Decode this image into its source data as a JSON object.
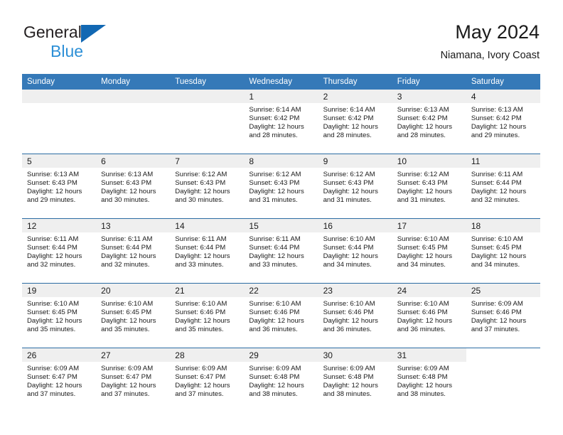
{
  "brand": {
    "name_part1": "General",
    "name_part2": "Blue",
    "logo_icon": "triangle-logo-icon",
    "accent_color": "#1268b3",
    "secondary_color": "#2c8fd6"
  },
  "header": {
    "title": "May 2024",
    "subtitle": "Niamana, Ivory Coast"
  },
  "theme": {
    "header_bg": "#3579b8",
    "row_divider": "#2b6ca3",
    "daynum_band_bg": "#efefef",
    "text_color": "#1a1a1a"
  },
  "calendar": {
    "weekday_headers": [
      "Sunday",
      "Monday",
      "Tuesday",
      "Wednesday",
      "Thursday",
      "Friday",
      "Saturday"
    ],
    "weeks": [
      [
        {
          "day": "",
          "lines": []
        },
        {
          "day": "",
          "lines": []
        },
        {
          "day": "",
          "lines": []
        },
        {
          "day": "1",
          "lines": [
            "Sunrise: 6:14 AM",
            "Sunset: 6:42 PM",
            "Daylight: 12 hours",
            "and 28 minutes."
          ]
        },
        {
          "day": "2",
          "lines": [
            "Sunrise: 6:14 AM",
            "Sunset: 6:42 PM",
            "Daylight: 12 hours",
            "and 28 minutes."
          ]
        },
        {
          "day": "3",
          "lines": [
            "Sunrise: 6:13 AM",
            "Sunset: 6:42 PM",
            "Daylight: 12 hours",
            "and 28 minutes."
          ]
        },
        {
          "day": "4",
          "lines": [
            "Sunrise: 6:13 AM",
            "Sunset: 6:42 PM",
            "Daylight: 12 hours",
            "and 29 minutes."
          ]
        }
      ],
      [
        {
          "day": "5",
          "lines": [
            "Sunrise: 6:13 AM",
            "Sunset: 6:43 PM",
            "Daylight: 12 hours",
            "and 29 minutes."
          ]
        },
        {
          "day": "6",
          "lines": [
            "Sunrise: 6:13 AM",
            "Sunset: 6:43 PM",
            "Daylight: 12 hours",
            "and 30 minutes."
          ]
        },
        {
          "day": "7",
          "lines": [
            "Sunrise: 6:12 AM",
            "Sunset: 6:43 PM",
            "Daylight: 12 hours",
            "and 30 minutes."
          ]
        },
        {
          "day": "8",
          "lines": [
            "Sunrise: 6:12 AM",
            "Sunset: 6:43 PM",
            "Daylight: 12 hours",
            "and 31 minutes."
          ]
        },
        {
          "day": "9",
          "lines": [
            "Sunrise: 6:12 AM",
            "Sunset: 6:43 PM",
            "Daylight: 12 hours",
            "and 31 minutes."
          ]
        },
        {
          "day": "10",
          "lines": [
            "Sunrise: 6:12 AM",
            "Sunset: 6:43 PM",
            "Daylight: 12 hours",
            "and 31 minutes."
          ]
        },
        {
          "day": "11",
          "lines": [
            "Sunrise: 6:11 AM",
            "Sunset: 6:44 PM",
            "Daylight: 12 hours",
            "and 32 minutes."
          ]
        }
      ],
      [
        {
          "day": "12",
          "lines": [
            "Sunrise: 6:11 AM",
            "Sunset: 6:44 PM",
            "Daylight: 12 hours",
            "and 32 minutes."
          ]
        },
        {
          "day": "13",
          "lines": [
            "Sunrise: 6:11 AM",
            "Sunset: 6:44 PM",
            "Daylight: 12 hours",
            "and 32 minutes."
          ]
        },
        {
          "day": "14",
          "lines": [
            "Sunrise: 6:11 AM",
            "Sunset: 6:44 PM",
            "Daylight: 12 hours",
            "and 33 minutes."
          ]
        },
        {
          "day": "15",
          "lines": [
            "Sunrise: 6:11 AM",
            "Sunset: 6:44 PM",
            "Daylight: 12 hours",
            "and 33 minutes."
          ]
        },
        {
          "day": "16",
          "lines": [
            "Sunrise: 6:10 AM",
            "Sunset: 6:44 PM",
            "Daylight: 12 hours",
            "and 34 minutes."
          ]
        },
        {
          "day": "17",
          "lines": [
            "Sunrise: 6:10 AM",
            "Sunset: 6:45 PM",
            "Daylight: 12 hours",
            "and 34 minutes."
          ]
        },
        {
          "day": "18",
          "lines": [
            "Sunrise: 6:10 AM",
            "Sunset: 6:45 PM",
            "Daylight: 12 hours",
            "and 34 minutes."
          ]
        }
      ],
      [
        {
          "day": "19",
          "lines": [
            "Sunrise: 6:10 AM",
            "Sunset: 6:45 PM",
            "Daylight: 12 hours",
            "and 35 minutes."
          ]
        },
        {
          "day": "20",
          "lines": [
            "Sunrise: 6:10 AM",
            "Sunset: 6:45 PM",
            "Daylight: 12 hours",
            "and 35 minutes."
          ]
        },
        {
          "day": "21",
          "lines": [
            "Sunrise: 6:10 AM",
            "Sunset: 6:46 PM",
            "Daylight: 12 hours",
            "and 35 minutes."
          ]
        },
        {
          "day": "22",
          "lines": [
            "Sunrise: 6:10 AM",
            "Sunset: 6:46 PM",
            "Daylight: 12 hours",
            "and 36 minutes."
          ]
        },
        {
          "day": "23",
          "lines": [
            "Sunrise: 6:10 AM",
            "Sunset: 6:46 PM",
            "Daylight: 12 hours",
            "and 36 minutes."
          ]
        },
        {
          "day": "24",
          "lines": [
            "Sunrise: 6:10 AM",
            "Sunset: 6:46 PM",
            "Daylight: 12 hours",
            "and 36 minutes."
          ]
        },
        {
          "day": "25",
          "lines": [
            "Sunrise: 6:09 AM",
            "Sunset: 6:46 PM",
            "Daylight: 12 hours",
            "and 37 minutes."
          ]
        }
      ],
      [
        {
          "day": "26",
          "lines": [
            "Sunrise: 6:09 AM",
            "Sunset: 6:47 PM",
            "Daylight: 12 hours",
            "and 37 minutes."
          ]
        },
        {
          "day": "27",
          "lines": [
            "Sunrise: 6:09 AM",
            "Sunset: 6:47 PM",
            "Daylight: 12 hours",
            "and 37 minutes."
          ]
        },
        {
          "day": "28",
          "lines": [
            "Sunrise: 6:09 AM",
            "Sunset: 6:47 PM",
            "Daylight: 12 hours",
            "and 37 minutes."
          ]
        },
        {
          "day": "29",
          "lines": [
            "Sunrise: 6:09 AM",
            "Sunset: 6:48 PM",
            "Daylight: 12 hours",
            "and 38 minutes."
          ]
        },
        {
          "day": "30",
          "lines": [
            "Sunrise: 6:09 AM",
            "Sunset: 6:48 PM",
            "Daylight: 12 hours",
            "and 38 minutes."
          ]
        },
        {
          "day": "31",
          "lines": [
            "Sunrise: 6:09 AM",
            "Sunset: 6:48 PM",
            "Daylight: 12 hours",
            "and 38 minutes."
          ]
        },
        {
          "day": "",
          "lines": [],
          "no_band": true
        }
      ]
    ]
  }
}
